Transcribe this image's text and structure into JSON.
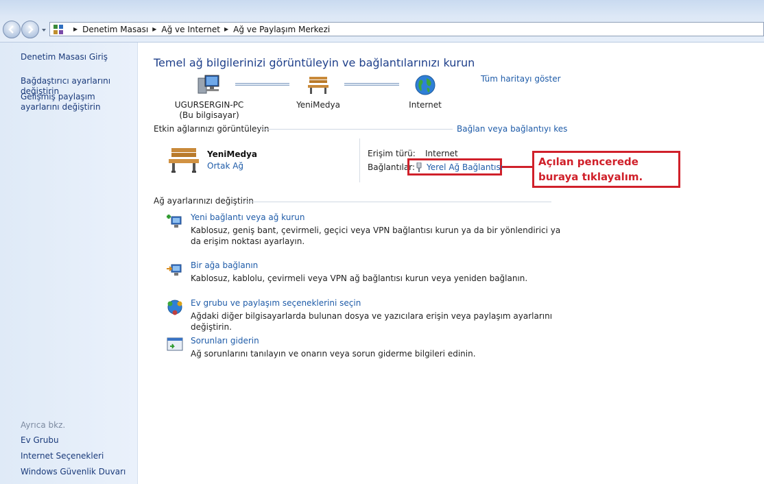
{
  "breadcrumb": {
    "items": [
      "Denetim Masası",
      "Ağ ve Internet",
      "Ağ ve Paylaşım Merkezi"
    ]
  },
  "sidebar": {
    "home": "Denetim Masası Giriş",
    "adapter": "Bağdaştırıcı ayarlarını değiştirin",
    "sharing": "Gelişmiş paylaşım ayarlarını değiştirin",
    "see_also": "Ayrıca bkz.",
    "links": [
      "Ev Grubu",
      "Internet Seçenekleri",
      "Windows Güvenlik Duvarı"
    ]
  },
  "main": {
    "title": "Temel ağ bilgilerinizi görüntüleyin ve bağlantılarınızı kurun",
    "full_map_link": "Tüm haritayı göster",
    "map": {
      "computer_name": "UGURSERGIN-PC",
      "computer_sub": "(Bu bilgisayar)",
      "network_name": "YeniMedya",
      "internet_label": "Internet"
    },
    "active_section": {
      "heading": "Etkin ağlarınızı görüntüleyin",
      "connect_link": "Bağlan veya bağlantıyı kes",
      "network_name": "YeniMedya",
      "network_type": "Ortak Ağ",
      "access_label": "Erişim türü:",
      "access_value": "Internet",
      "connections_label": "Bağlantılar:",
      "connection_link": "Yerel Ağ Bağlantısı"
    },
    "callout": "Açılan pencerede buraya tıklayalım.",
    "settings_section": {
      "heading": "Ağ ayarlarınızı değiştirin",
      "tasks": [
        {
          "link": "Yeni bağlantı veya ağ kurun",
          "desc": "Kablosuz, geniş bant, çevirmeli, geçici veya VPN bağlantısı kurun ya da bir yönlendirici ya da erişim noktası ayarlayın."
        },
        {
          "link": "Bir ağa bağlanın",
          "desc": "Kablosuz, kablolu, çevirmeli veya VPN ağ bağlantısı kurun veya yeniden bağlanın."
        },
        {
          "link": "Ev grubu ve paylaşım seçeneklerini seçin",
          "desc": "Ağdaki diğer bilgisayarlarda bulunan dosya ve yazıcılara erişin veya paylaşım ayarlarını değiştirin."
        },
        {
          "link": "Sorunları giderin",
          "desc": "Ağ sorunlarını tanılayın ve onarın veya sorun giderme bilgileri edinin."
        }
      ]
    }
  },
  "colors": {
    "link": "#1e5ba8",
    "title": "#1e3f8a",
    "annotation": "#d0202a"
  },
  "icons": [
    "back-arrow-icon",
    "forward-arrow-icon",
    "control-panel-icon",
    "computer-icon",
    "bench-icon",
    "globe-icon",
    "cable-plug-icon",
    "new-connection-icon",
    "connect-network-icon",
    "homegroup-icon",
    "troubleshoot-icon"
  ]
}
